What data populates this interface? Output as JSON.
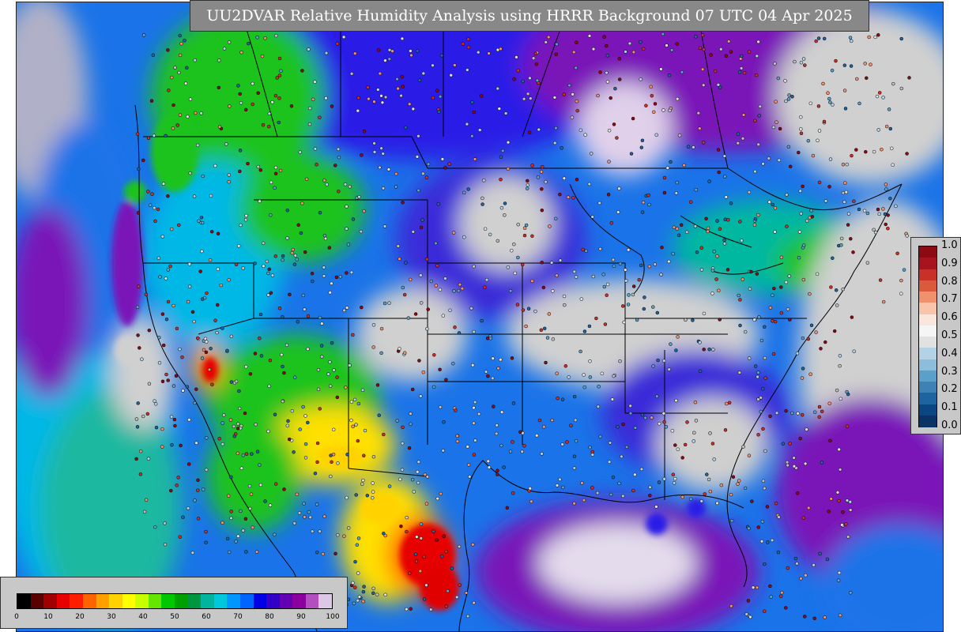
{
  "title": "UU2DVAR Relative Humidity Analysis using HRRR Background 07 UTC 04 Apr 2025",
  "innovation_colorbar": {
    "tick_labels": [
      "1.0",
      "0.9",
      "0.8",
      "0.7",
      "0.6",
      "0.5",
      "0.4",
      "0.3",
      "0.2",
      "0.1",
      "0.0"
    ],
    "colors_top_to_bottom": [
      "#8b0a14",
      "#a8141e",
      "#c83028",
      "#dc5a3c",
      "#f0916e",
      "#f8c4aa",
      "#fae6dc",
      "#f5f5f5",
      "#e1e1e1",
      "#b4d2e6",
      "#8cbedc",
      "#5aa0c8",
      "#3c82b4",
      "#1e64a0",
      "#0a4682",
      "#0a3264"
    ]
  },
  "rh_colorbar": {
    "tick_labels": [
      "0",
      "10",
      "20",
      "30",
      "40",
      "50",
      "60",
      "70",
      "80",
      "90",
      "100"
    ],
    "colors": [
      "#000000",
      "#5a0000",
      "#a00000",
      "#e60000",
      "#ff1e00",
      "#ff6400",
      "#ffa000",
      "#ffd200",
      "#ffff00",
      "#c8ff00",
      "#64e600",
      "#00c800",
      "#00a000",
      "#009640",
      "#00b4a0",
      "#00c8dc",
      "#0096ff",
      "#0064ff",
      "#0000e6",
      "#3200c8",
      "#6400b4",
      "#8c00a0",
      "#b450be",
      "#dcc8e6"
    ]
  },
  "map_colors": {
    "ocean_blue": "#1a73e8",
    "ocean_purple": "#7a12b8",
    "saturated_gray": "#cfcfcf",
    "dry_red": "#e10000",
    "dry_yellow": "#ffe000",
    "mid_green": "#1fc31f",
    "cyan": "#00b8e6",
    "land_blue": "#2a1ee6"
  }
}
